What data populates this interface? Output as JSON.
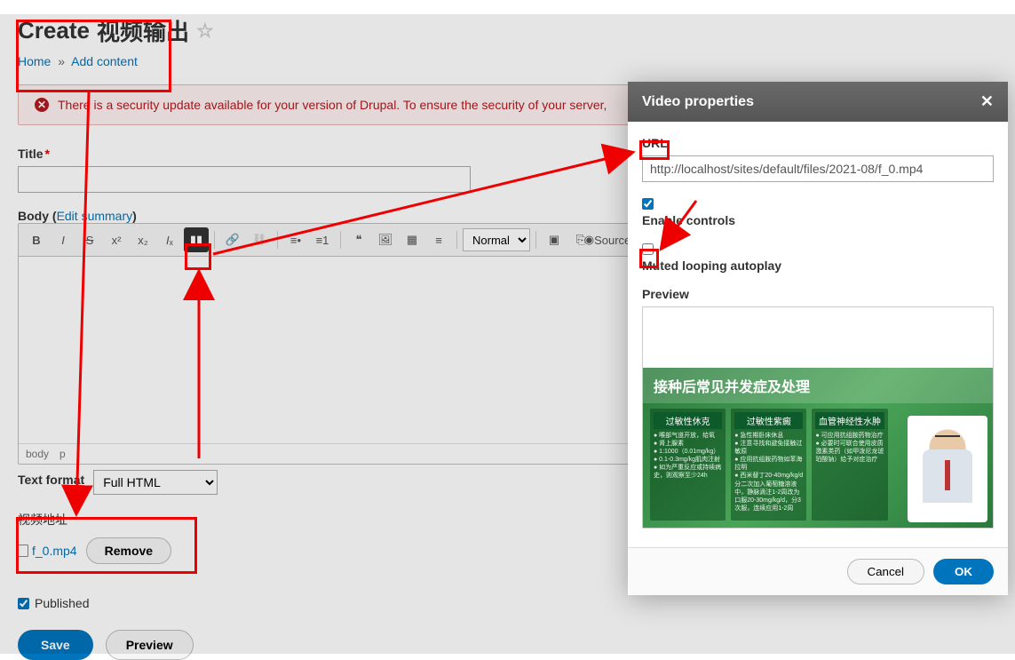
{
  "header": {
    "title_prefix": "Create",
    "title_suffix": "视频输出"
  },
  "breadcrumb": {
    "home": "Home",
    "add_content": "Add content"
  },
  "alert": {
    "text": "There is a security update available for your version of Drupal. To ensure the security of your server,"
  },
  "form": {
    "title_label": "Title",
    "body_label": "Body",
    "edit_summary": "Edit summary",
    "format_label": "Text format",
    "format_value": "Full HTML",
    "footer_path": "body",
    "footer_p": "p",
    "video_section_label": "视频地址",
    "file_name": "f_0.mp4",
    "remove_label": "Remove",
    "published_label": "Published",
    "save_label": "Save",
    "preview_label": "Preview"
  },
  "toolbar": {
    "normal": "Normal",
    "source": "Source"
  },
  "dialog": {
    "title": "Video properties",
    "url_label": "URL",
    "url_value": "http://localhost/sites/default/files/2021-08/f_0.mp4",
    "enable_controls": "Enable controls",
    "muted_loop": "Muted looping autoplay",
    "preview_label": "Preview",
    "cancel": "Cancel",
    "ok": "OK"
  },
  "video_preview": {
    "main_title": "接种后常见并发症及处理",
    "col1_h": "过敏性休克",
    "col2_h": "过敏性紫癜",
    "col3_h": "血管神经性水肿"
  }
}
